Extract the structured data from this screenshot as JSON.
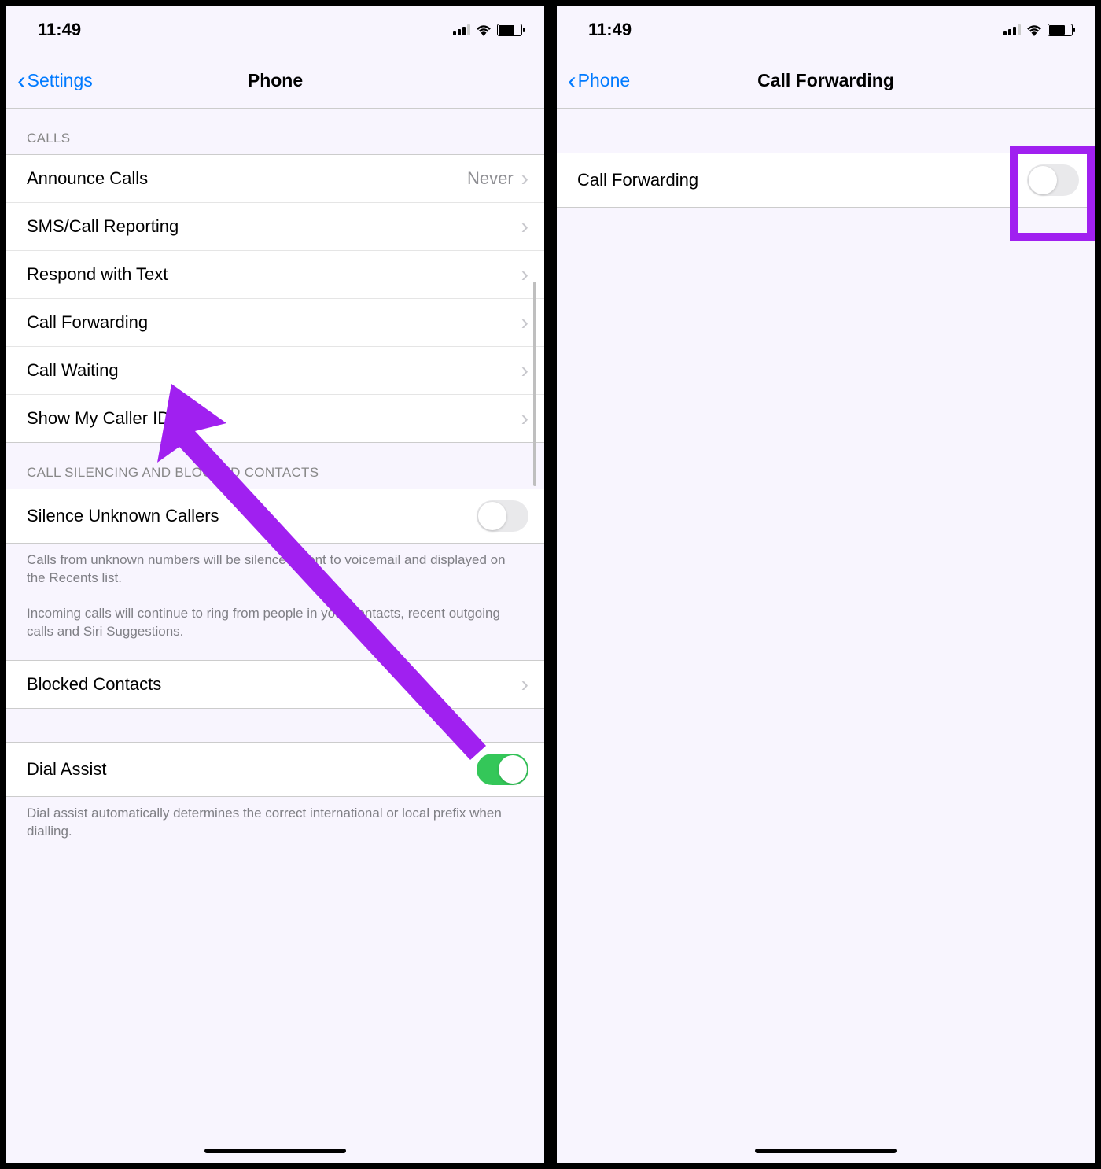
{
  "status_time": "11:49",
  "screen1": {
    "back_label": "Settings",
    "title": "Phone",
    "section_calls_header": "CALLS",
    "rows_calls": [
      {
        "label": "Announce Calls",
        "detail": "Never"
      },
      {
        "label": "SMS/Call Reporting"
      },
      {
        "label": "Respond with Text"
      },
      {
        "label": "Call Forwarding"
      },
      {
        "label": "Call Waiting"
      },
      {
        "label": "Show My Caller ID"
      }
    ],
    "section_silencing_header": "CALL SILENCING AND BLOCKED CONTACTS",
    "silence_row_label": "Silence Unknown Callers",
    "silence_footer1": "Calls from unknown numbers will be silenced, sent to voicemail and displayed on the Recents list.",
    "silence_footer2": "Incoming calls will continue to ring from people in your contacts, recent outgoing calls and Siri Suggestions.",
    "blocked_label": "Blocked Contacts",
    "dial_assist_label": "Dial Assist",
    "dial_assist_footer": "Dial assist automatically determines the correct international or local prefix when dialling."
  },
  "screen2": {
    "back_label": "Phone",
    "title": "Call Forwarding",
    "row_label": "Call Forwarding"
  }
}
